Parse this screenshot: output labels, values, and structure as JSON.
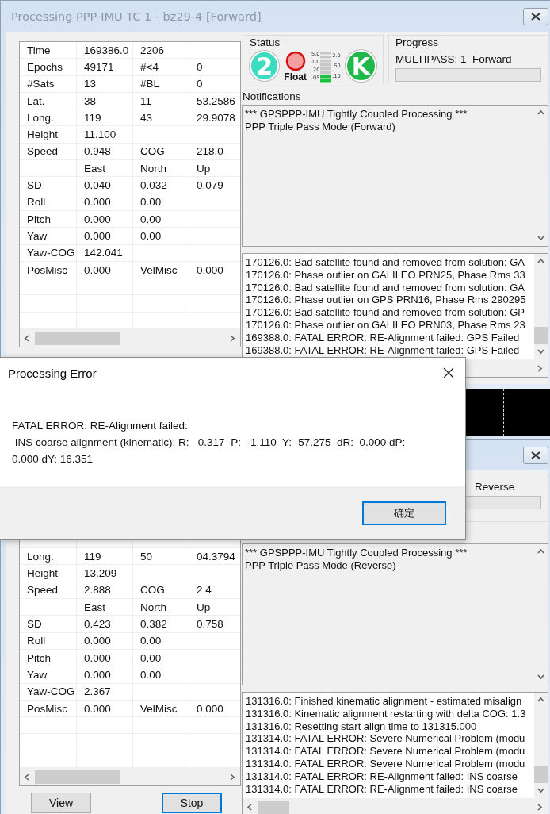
{
  "windows": [
    {
      "title": "Processing PPP-IMU TC 1 - bz29-4 [Forward]",
      "status": {
        "label": "Status",
        "satellite_count": "2",
        "float_label": "Float",
        "mode_letter": "K",
        "meter": {
          "left_labels": [
            "5.0",
            "1.0",
            ".20",
            ".05"
          ],
          "right_labels": [
            "2.0",
            ".50",
            ".10"
          ],
          "level": 0.25
        }
      },
      "progress": {
        "label": "Progress",
        "text": "MULTIPASS: 1  Forward",
        "level": 0
      },
      "stats_table": {
        "rows": [
          {
            "label": "Time",
            "col_2": "169386.0",
            "col_3": "2206"
          },
          {
            "label": "Epochs",
            "col_2": "49171",
            "col_3": "#<4",
            "col_4": "0"
          },
          {
            "label": "#Sats",
            "col_2": "13",
            "col_3": "#BL",
            "col_4": "0"
          },
          {
            "label": "Lat.",
            "col_2": "38",
            "col_3": "11",
            "col_4": "53.2586"
          },
          {
            "label": "Long.",
            "col_2": "119",
            "col_3": "43",
            "col_4": "29.9078"
          },
          {
            "label": "Height",
            "col_2": "11.100"
          },
          {
            "label": "Speed",
            "col_2": "0.948",
            "col_3": "COG",
            "col_4": "218.0"
          },
          {
            "col_2": "East",
            "col_3": "North",
            "col_4": "Up"
          },
          {
            "label": "SD",
            "col_2": "0.040",
            "col_3": "0.032",
            "col_4": "0.079"
          },
          {
            "label": "Roll",
            "col_2": "0.000",
            "col_3": "0.00"
          },
          {
            "label": "Pitch",
            "col_2": "0.000",
            "col_3": "0.00"
          },
          {
            "label": "Yaw",
            "col_2": "0.000",
            "col_3": "0.00"
          },
          {
            "label": "Yaw-COG",
            "col_2": "142.041"
          },
          {
            "label": "PosMisc",
            "col_2": "0.000",
            "col_3": "VelMisc",
            "col_4": "0.000"
          }
        ]
      },
      "notifications": {
        "label": "Notifications",
        "lines": [
          "*** GPSPPP-IMU Tightly Coupled Processing ***",
          "PPP Triple Pass Mode (Forward)"
        ]
      },
      "log": {
        "lines": [
          "170126.0: Bad satellite found and removed from solution: GA",
          "170126.0: Phase outlier on GALILEO PRN25, Phase Rms 33",
          "170126.0: Bad satellite found and removed from solution: GA",
          "170126.0: Phase outlier on GPS PRN16, Phase Rms 290295",
          "170126.0: Bad satellite found and removed from solution: GP",
          "170126.0: Phase outlier on GALILEO PRN03, Phase Rms 23",
          "169388.0: FATAL ERROR: RE-Alignment failed: GPS Failed",
          "169388.0: FATAL ERROR: RE-Alignment failed: GPS Failed"
        ]
      }
    },
    {
      "progress": {
        "text": "Reverse",
        "level": 0
      },
      "stats_table": {
        "rows": [
          {
            "label": "Long.",
            "col_2": "119",
            "col_3": "50",
            "col_4": "04.3794"
          },
          {
            "label": "Height",
            "col_2": "13.209"
          },
          {
            "label": "Speed",
            "col_2": "2.888",
            "col_3": "COG",
            "col_4": "2.4"
          },
          {
            "col_2": "East",
            "col_3": "North",
            "col_4": "Up"
          },
          {
            "label": "SD",
            "col_2": "0.423",
            "col_3": "0.382",
            "col_4": "0.758"
          },
          {
            "label": "Roll",
            "col_2": "0.000",
            "col_3": "0.00"
          },
          {
            "label": "Pitch",
            "col_2": "0.000",
            "col_3": "0.00"
          },
          {
            "label": "Yaw",
            "col_2": "0.000",
            "col_3": "0.00"
          },
          {
            "label": "Yaw-COG",
            "col_2": "2.367"
          },
          {
            "label": "PosMisc",
            "col_2": "0.000",
            "col_3": "VelMisc",
            "col_4": "0.000"
          }
        ]
      },
      "notifications": {
        "lines": [
          "*** GPSPPP-IMU Tightly Coupled Processing ***",
          "PPP Triple Pass Mode (Reverse)"
        ]
      },
      "log": {
        "lines": [
          "131316.0: Finished kinematic alignment - estimated misalign",
          "131316.0: Kinematic alignment restarting with delta COG: 1.3",
          "131316.0: Resetting start align time to 131315.000",
          "131314.0: FATAL ERROR: Severe Numerical Problem (modu",
          "131314.0: FATAL ERROR: Severe Numerical Problem (modu",
          "131314.0: FATAL ERROR: Severe Numerical Problem (modu",
          "131314.0: FATAL ERROR: RE-Alignment failed: INS coarse",
          "131314.0: FATAL ERROR: RE-Alignment failed: INS coarse"
        ]
      },
      "buttons": [
        {
          "label": "View",
          "focused": false
        },
        {
          "label": "Stop",
          "focused": true
        }
      ]
    }
  ],
  "error_dialog": {
    "title": "Processing Error",
    "message": [
      "FATAL ERROR: RE-Alignment failed:",
      " INS coarse alignment (kinematic): R:   0.317  P:  -1.110  Y: -57.275  dR:  0.000 dP: 0.000 dY: 16.351"
    ],
    "button": "确定"
  }
}
